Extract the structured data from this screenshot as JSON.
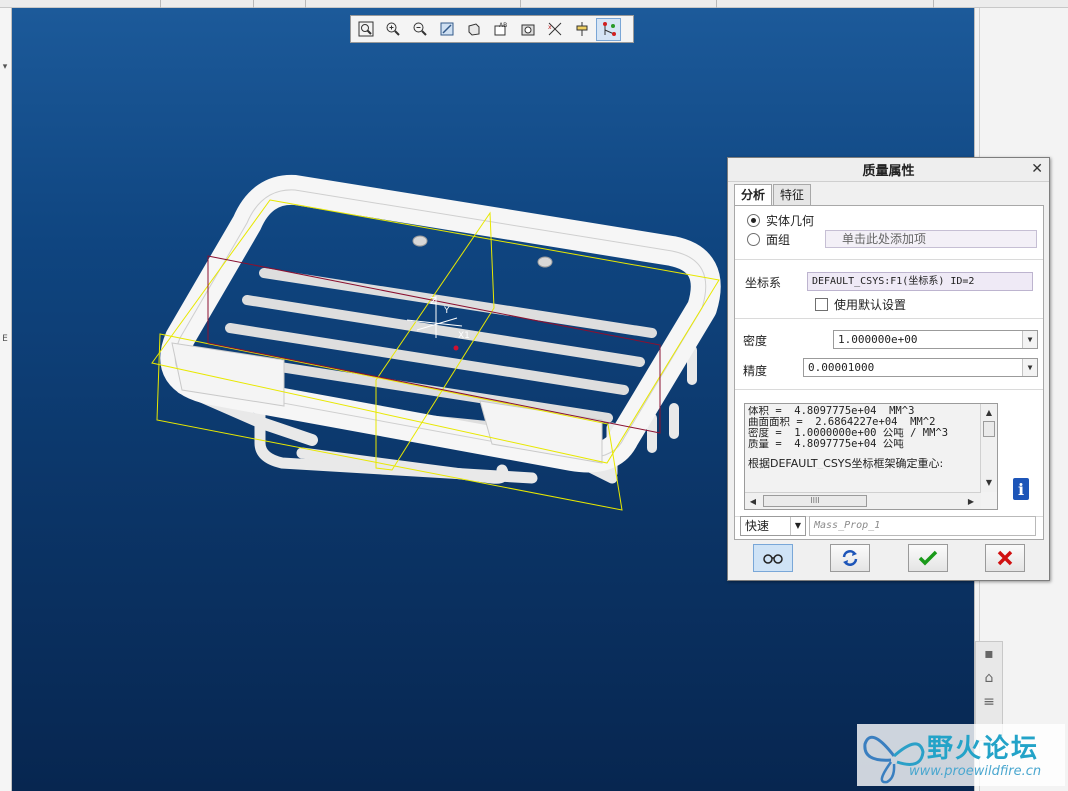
{
  "dialog": {
    "title": "质量属性",
    "tabs": [
      {
        "label": "分析",
        "active": true
      },
      {
        "label": "特征",
        "active": false
      }
    ],
    "geometry_options": [
      {
        "label": "实体几何",
        "checked": true
      },
      {
        "label": "面组",
        "checked": false
      }
    ],
    "add_item_placeholder": "单击此处添加项",
    "csys_label": "坐标系",
    "csys_value": "DEFAULT_CSYS:F1(坐标系) ID=2",
    "use_default_label": "使用默认设置",
    "density_label": "密度",
    "density_value": "1.000000e+00",
    "precision_label": "精度",
    "precision_value": "0.00001000",
    "results": [
      "体积 =  4.8097775e+04  MM^3",
      "曲面面积 =  2.6864227e+04  MM^2",
      "密度 =  1.0000000e+00 公吨 / MM^3",
      "质量 =  4.8097775e+04 公吨"
    ],
    "results_footer": "根据DEFAULT_CSYS坐标框架确定重心:",
    "mode_value": "快速",
    "name_value": "Mass_Prop_1"
  },
  "watermark": {
    "title": "野火论坛",
    "url": "www.proewildfire.cn"
  },
  "model_labels": {
    "z": "Z",
    "y": "Y",
    "x": "X1"
  },
  "colors": {
    "viewport_top": "#1c5a9a",
    "viewport_bottom": "#072650",
    "bbox_yellow": "#e8e800",
    "datum_red": "#8a1030",
    "ok_green": "#1a9a1a",
    "cancel_red": "#d01010"
  },
  "toolbar_icons": [
    "refit-icon",
    "zoom-in-icon",
    "zoom-out-icon",
    "repaint-icon",
    "display-style-icon",
    "annotation-display-icon",
    "saved-orientations-icon",
    "datum-display-icon",
    "spin-center-icon",
    "csys-display-icon"
  ]
}
